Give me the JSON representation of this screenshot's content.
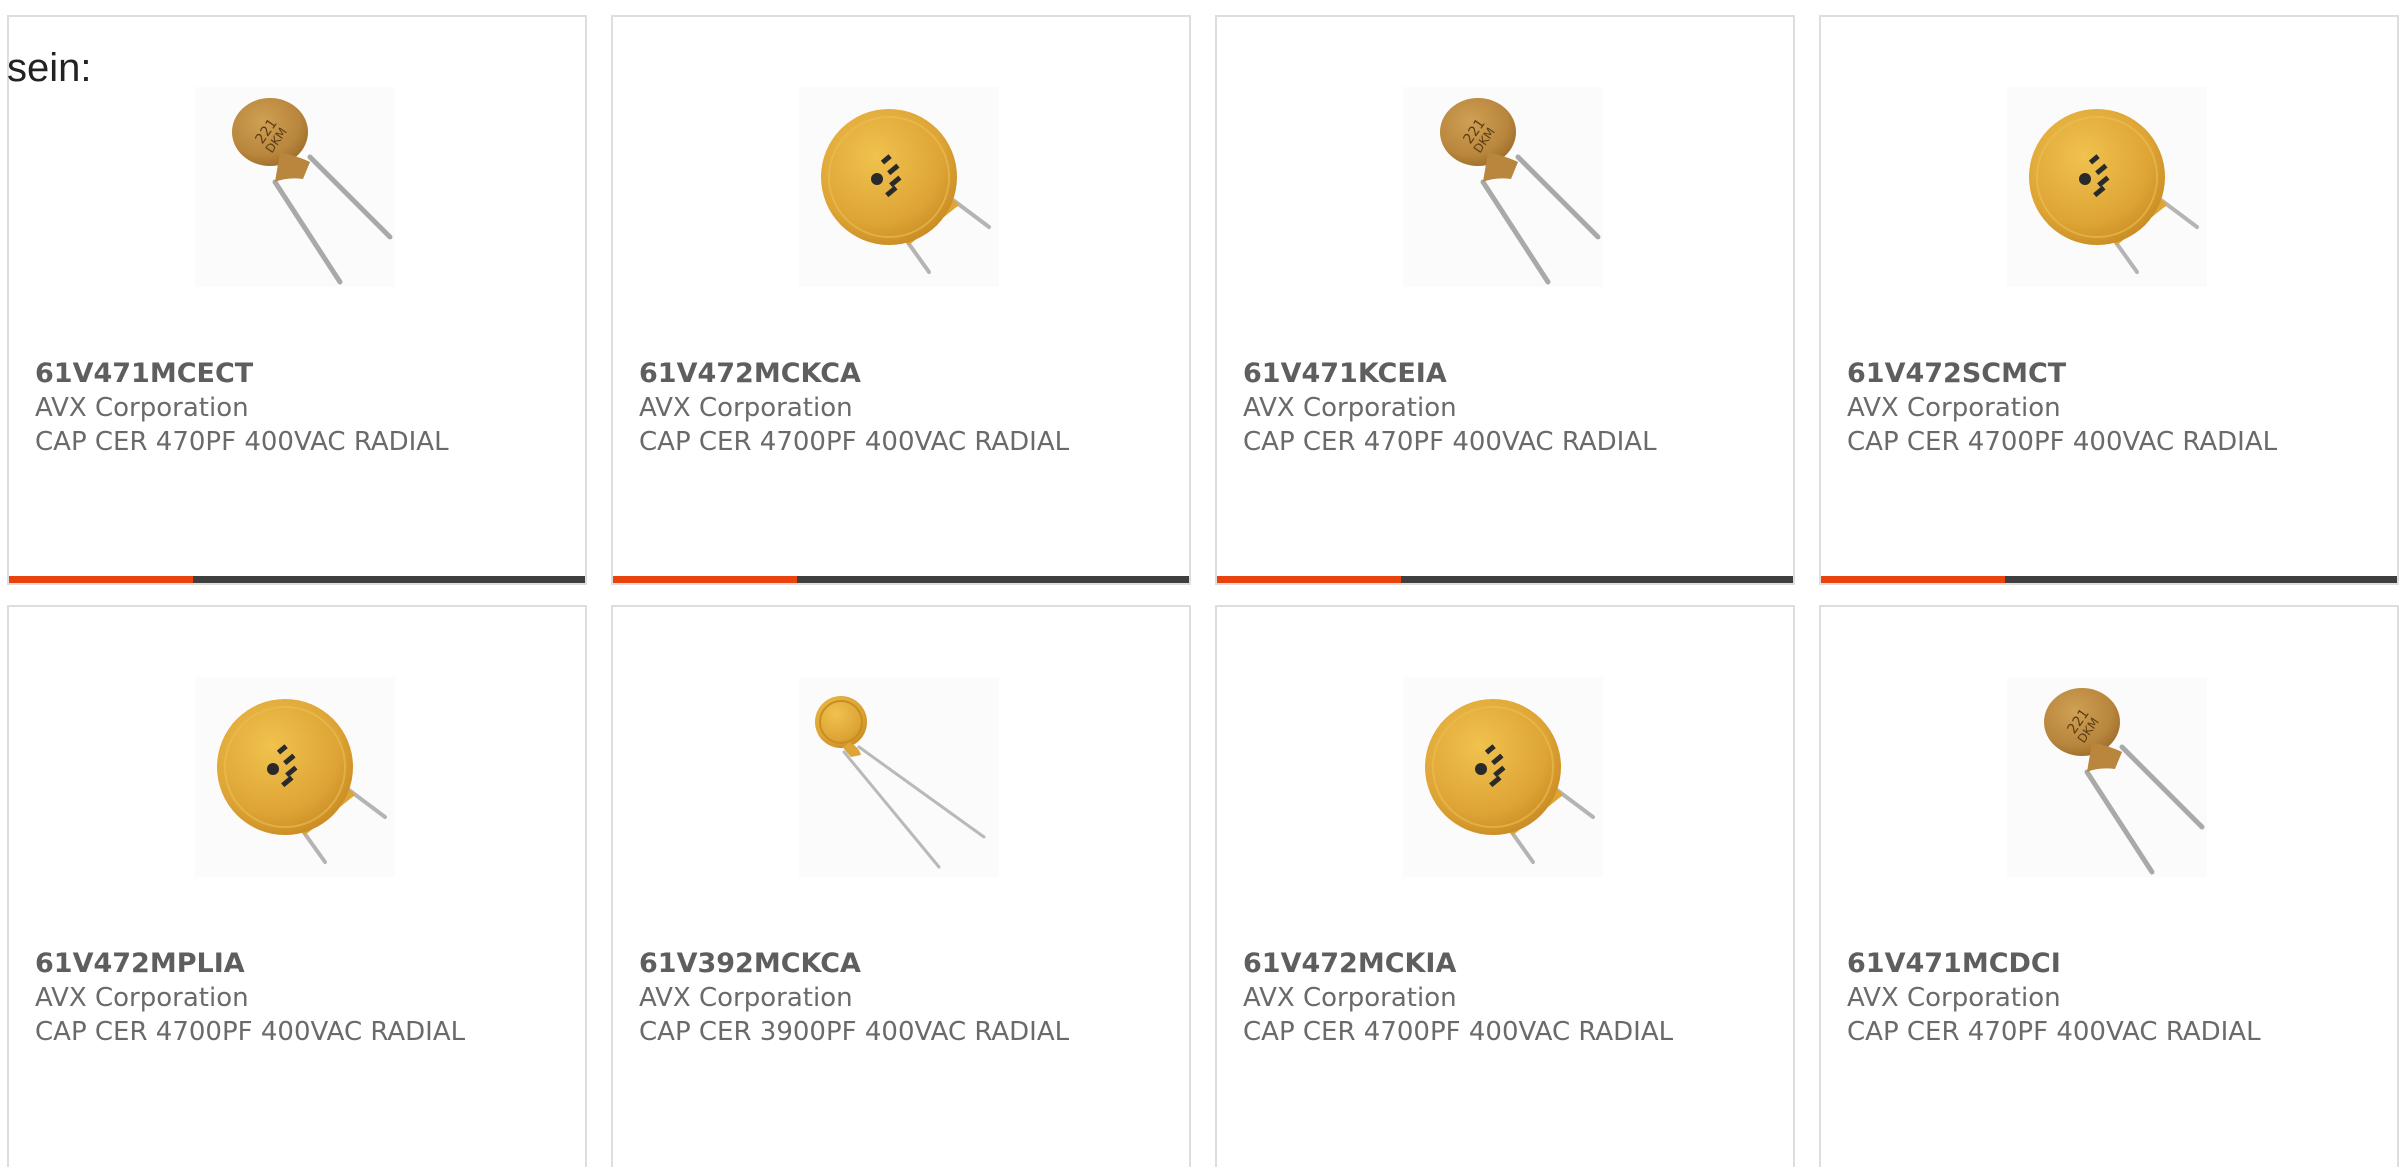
{
  "lead_text": "sein:",
  "colors": {
    "accent": "#e8430c",
    "bar_track": "#3f3f3f",
    "card_border": "#dedede",
    "text_gray": "#6a6a6a",
    "capacitor_body": "#dea435",
    "capacitor_brown": "#b8863c"
  },
  "cards": [
    {
      "part": "61V471MCECT",
      "maker": "AVX Corporation",
      "desc": "CAP CER 470PF 400VAC RADIAL",
      "image": "small-brown-disc-capacitor",
      "progress": 0.32
    },
    {
      "part": "61V472MCKCA",
      "maker": "AVX Corporation",
      "desc": "CAP CER 4700PF 400VAC RADIAL",
      "image": "large-yellow-disc-capacitor",
      "progress": 0.32
    },
    {
      "part": "61V471KCEIA",
      "maker": "AVX Corporation",
      "desc": "CAP CER 470PF 400VAC RADIAL",
      "image": "small-brown-disc-capacitor",
      "progress": 0.32
    },
    {
      "part": "61V472SCMCT",
      "maker": "AVX Corporation",
      "desc": "CAP CER 4700PF 400VAC RADIAL",
      "image": "large-yellow-disc-capacitor",
      "progress": 0.32
    },
    {
      "part": "61V472MPLIA",
      "maker": "AVX Corporation",
      "desc": "CAP CER 4700PF 400VAC RADIAL",
      "image": "large-yellow-disc-capacitor",
      "progress": null
    },
    {
      "part": "61V392MCKCA",
      "maker": "AVX Corporation",
      "desc": "CAP CER 3900PF 400VAC RADIAL",
      "image": "tiny-disc-capacitor",
      "progress": null
    },
    {
      "part": "61V472MCKIA",
      "maker": "AVX Corporation",
      "desc": "CAP CER 4700PF 400VAC RADIAL",
      "image": "large-yellow-disc-capacitor",
      "progress": null
    },
    {
      "part": "61V471MCDCI",
      "maker": "AVX Corporation",
      "desc": "CAP CER 470PF 400VAC RADIAL",
      "image": "small-brown-disc-capacitor",
      "progress": null
    }
  ]
}
